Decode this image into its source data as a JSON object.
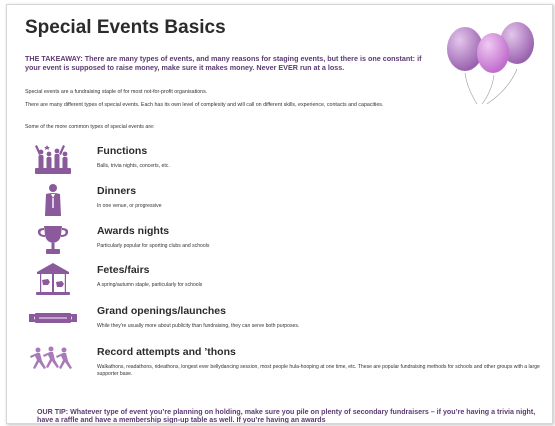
{
  "document": {
    "title": "Special Events Basics",
    "takeaway": "THE TAKEAWAY: There are many types of events, and many reasons for staging events, but there is one constant: if your event is supposed to raise money, make sure it makes money. Never EVER run at a loss.",
    "paragraphs": [
      "Special events are a fundraising staple of for most not-for-profit organisations.",
      "There are many different types of special events. Each has its own level of complexity and will call on different skills, experience, contacts and capacities.",
      "Some of the more common types of special events are:"
    ],
    "events": [
      {
        "title": "Functions",
        "description": "Balls, trivia nights, concerts, etc.",
        "icon": "crowd-celebration-icon"
      },
      {
        "title": "Dinners",
        "description": "In one venue, or progressive",
        "icon": "waiter-icon"
      },
      {
        "title": "Awards nights",
        "description": "Particularly popular for sporting clubs and schools",
        "icon": "trophy-icon"
      },
      {
        "title": "Fetes/fairs",
        "description": "A spring/autumn staple, particularly for schools",
        "icon": "carousel-icon"
      },
      {
        "title": "Grand openings/launches",
        "description": "While they're usually more about publicity than fundraising, they can serve both purposes.",
        "icon": "ribbon-banner-icon"
      },
      {
        "title": "Record attempts and ’thons",
        "description": "Walkathons, readathons, rideathons, longest ever bellydancing session, most people hula-hooping at one time, etc. These are popular fundraising methods for schools and other groups with a large supporter base.",
        "icon": "runners-icon"
      }
    ],
    "tip": "OUR TIP: Whatever type of event you’re planning on holding, make sure you pile on plenty of secondary fundraisers – if you’re having a trivia night, have a raffle and have a membership sign-up table as well. If you’re having an awards",
    "colors": {
      "accent_purple": "#5c3a72",
      "icon_purple": "#8a5a9c",
      "balloon_purple": "#b57fc4"
    }
  }
}
